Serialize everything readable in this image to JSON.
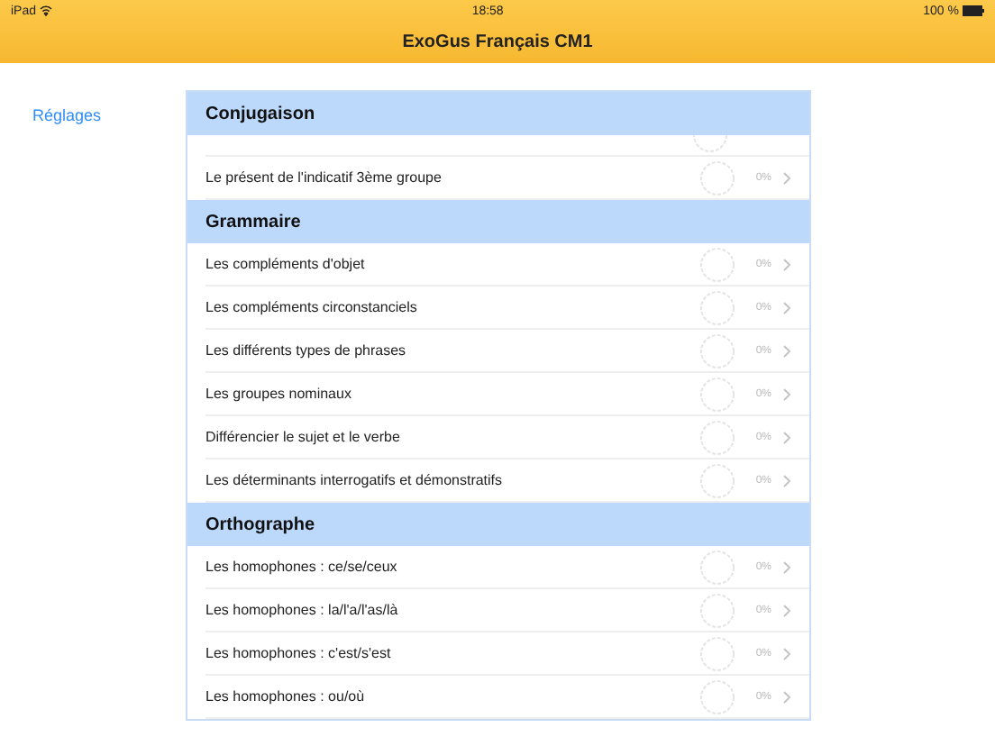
{
  "status_bar": {
    "device": "iPad",
    "time": "18:58",
    "battery": "100 %"
  },
  "nav_bar": {
    "title": "ExoGus Français CM1"
  },
  "sidebar": {
    "link": "Réglages"
  },
  "sections": [
    {
      "title": "Conjugaison",
      "rows": [
        {
          "label": "Le présent de l'indicatif 3ème groupe",
          "percent": "0%"
        }
      ]
    },
    {
      "title": "Grammaire",
      "rows": [
        {
          "label": "Les compléments d'objet",
          "percent": "0%"
        },
        {
          "label": "Les compléments circonstanciels",
          "percent": "0%"
        },
        {
          "label": "Les différents types de phrases",
          "percent": "0%"
        },
        {
          "label": "Les groupes nominaux",
          "percent": "0%"
        },
        {
          "label": "Différencier le sujet et le verbe",
          "percent": "0%"
        },
        {
          "label": "Les déterminants interrogatifs et démonstratifs",
          "percent": "0%"
        }
      ]
    },
    {
      "title": "Orthographe",
      "rows": [
        {
          "label": "Les homophones : ce/se/ceux",
          "percent": "0%"
        },
        {
          "label": "Les homophones : la/l'a/l'as/là",
          "percent": "0%"
        },
        {
          "label": "Les homophones : c'est/s'est",
          "percent": "0%"
        },
        {
          "label": "Les homophones : ou/où",
          "percent": "0%"
        }
      ]
    }
  ]
}
